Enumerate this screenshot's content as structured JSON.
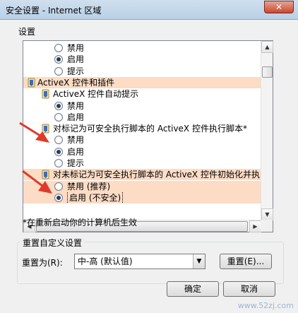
{
  "window": {
    "title": "安全设置 - Internet 区域",
    "close_label": "✕"
  },
  "settings": {
    "label": "设置",
    "rows": [
      {
        "kind": "radio",
        "label": "禁用",
        "checked": false
      },
      {
        "kind": "radio",
        "label": "启用",
        "checked": true
      },
      {
        "kind": "radio",
        "label": "提示",
        "checked": false
      },
      {
        "kind": "category",
        "label": "ActiveX 控件和插件"
      },
      {
        "kind": "item",
        "label": "ActiveX 控件自动提示"
      },
      {
        "kind": "radio",
        "label": "禁用",
        "checked": true
      },
      {
        "kind": "radio",
        "label": "启用",
        "checked": false
      },
      {
        "kind": "item",
        "label": "对标记为可安全执行脚本的 ActiveX 控件执行脚本*"
      },
      {
        "kind": "radio",
        "label": "禁用",
        "checked": false
      },
      {
        "kind": "radio",
        "label": "启用",
        "checked": true
      },
      {
        "kind": "radio",
        "label": "提示",
        "checked": false
      },
      {
        "kind": "item",
        "label": "对未标记为可安全执行脚本的 ActiveX 控件初始化并执"
      },
      {
        "kind": "radio",
        "label": "禁用 (推荐)",
        "checked": false
      },
      {
        "kind": "radio",
        "label": "启用 (不安全)",
        "checked": true
      }
    ],
    "note": "*在重新启动你的计算机后生效"
  },
  "reset": {
    "group_label": "重置自定义设置",
    "reset_to_label": "重置为(R):",
    "selected_level": "中-高 (默认值)",
    "reset_button": "重置(E)..."
  },
  "footer": {
    "ok_label": "确定",
    "cancel_label": "取消"
  },
  "watermark": "www.52zj.com",
  "colors": {
    "highlight": "#fcdcc4",
    "arrow": "#e03a2a"
  }
}
